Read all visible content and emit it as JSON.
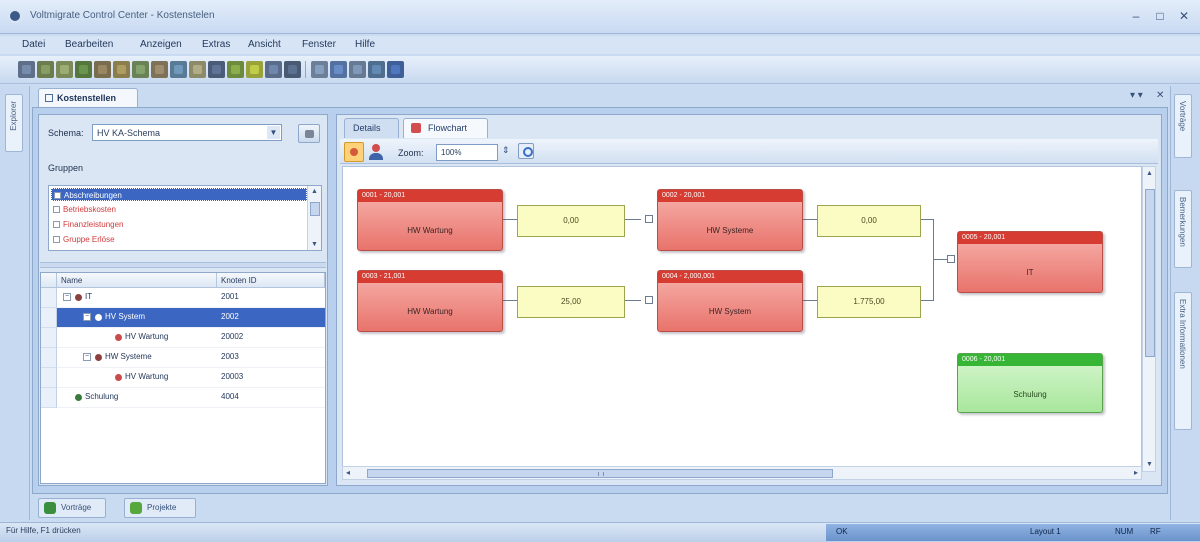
{
  "window": {
    "title": "Voltmigrate Control Center - Kostenstelen",
    "minimize": "–",
    "maximize": "□",
    "close": "✕"
  },
  "menu": [
    "Datei",
    "Bearbeiten",
    "Anzeigen",
    "Extras",
    "Ansicht",
    "Fenster",
    "Hilfe"
  ],
  "toolbar": {
    "icon_colors": [
      "#5f6f8a",
      "#6b7d4e",
      "#7c8a5a",
      "#55773e",
      "#7a6c4f",
      "#8c7d4d",
      "#6a8256",
      "#7e7158",
      "#587a95",
      "#8d8a6a",
      "#4b5c78",
      "#6e8b3d",
      "#9aa33a",
      "#5a6c8a",
      "#4a5a73",
      "#6c7f98",
      "#5470a0",
      "#667a94",
      "#4f6e8f",
      "#3f5f98"
    ]
  },
  "left_strip": {
    "tab_label": "Explorer"
  },
  "document_tab": {
    "label": "Kostenstellen"
  },
  "pane_controls": {
    "pin": "▾ ▾",
    "close": "✕"
  },
  "left_panel": {
    "schema": {
      "label": "Schema:",
      "value": "HV KA-Schema",
      "dropdown_arrow": "▼"
    },
    "gruppen": {
      "label": "Gruppen",
      "items": [
        {
          "label": "Abschreibungen",
          "selected": true
        },
        {
          "label": "Betriebskosten",
          "selected": false
        },
        {
          "label": "Finanzleistungen",
          "selected": false
        },
        {
          "label": "Gruppe Erlöse",
          "selected": false
        }
      ],
      "scroll_up": "▲",
      "scroll_down": "▼"
    },
    "tree": {
      "columns": [
        "Name",
        "Knoten ID"
      ],
      "rows": [
        {
          "name": "IT",
          "id": "2001",
          "level": 0,
          "selected": false
        },
        {
          "name": "HV System",
          "id": "2002",
          "level": 1,
          "selected": true
        },
        {
          "name": "HV Wartung",
          "id": "20002",
          "level": 2,
          "selected": false
        },
        {
          "name": "HW Systeme",
          "id": "2003",
          "level": 1,
          "selected": false
        },
        {
          "name": "HV Wartung",
          "id": "20003",
          "level": 2,
          "selected": false
        },
        {
          "name": "Schulung",
          "id": "4004",
          "level": 0,
          "selected": false
        }
      ]
    }
  },
  "right_panel": {
    "tabs": [
      {
        "label": "Details",
        "active": false
      },
      {
        "label": "Flowchart",
        "active": true
      }
    ],
    "zoom": {
      "label": "Zoom:",
      "value": "100%",
      "spin": "⇕"
    }
  },
  "flowchart": {
    "nodes": [
      {
        "id": "n1",
        "header": "0001 - 20,001",
        "label": "HW Wartung",
        "color": "red"
      },
      {
        "id": "n2",
        "header": "0002 - 20,001",
        "label": "HW Systeme",
        "color": "red"
      },
      {
        "id": "n3",
        "header": "0003 - 21,001",
        "label": "HW Wartung",
        "color": "red"
      },
      {
        "id": "n4",
        "header": "0004 - 2,000,001",
        "label": "HW System",
        "color": "red"
      },
      {
        "id": "n5",
        "header": "0005 - 20,001",
        "label": "IT",
        "color": "red"
      },
      {
        "id": "n6",
        "header": "0006 - 20,001",
        "label": "Schulung",
        "color": "green"
      }
    ],
    "values": [
      {
        "id": "v1",
        "value": "0,00"
      },
      {
        "id": "v2",
        "value": "0,00"
      },
      {
        "id": "v3",
        "value": "25,00"
      },
      {
        "id": "v4",
        "value": "1.775,00"
      }
    ],
    "scroll": {
      "up": "▲",
      "down": "▼",
      "left": "◂",
      "right": "▸"
    }
  },
  "right_strip": {
    "tabs": [
      "Vorträge",
      "Bemerkungen",
      "Extra Informationen"
    ]
  },
  "bottom_tabs": [
    {
      "label": "Vorträge",
      "icon_color": "#3a8f3f"
    },
    {
      "label": "Projekte",
      "icon_color": "#57a83c"
    }
  ],
  "status": {
    "left": "Für Hilfe, F1 drücken",
    "field1": "OK",
    "field2": "Layout 1",
    "field3": "NUM",
    "field4": "RF"
  }
}
